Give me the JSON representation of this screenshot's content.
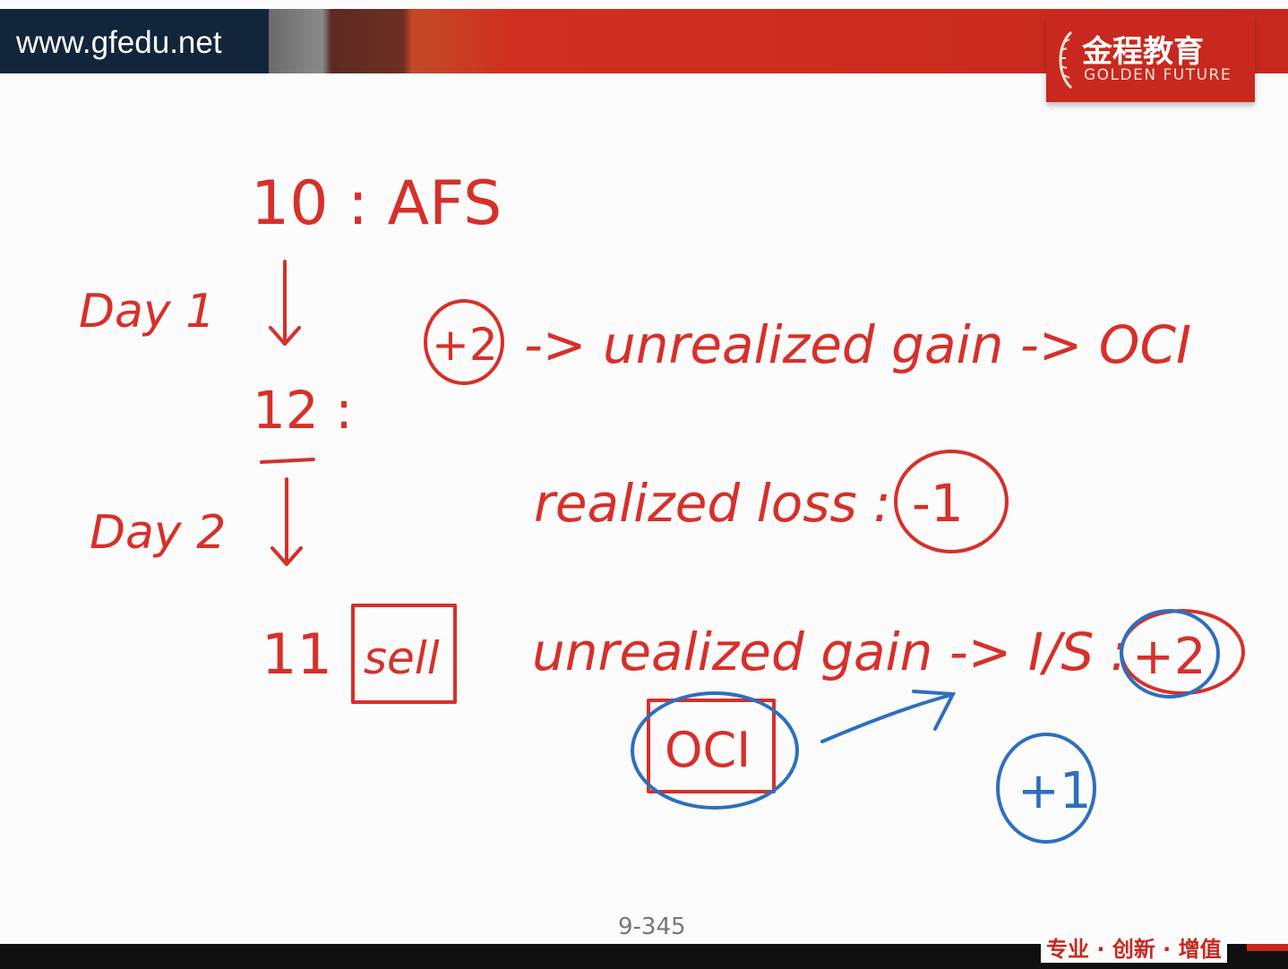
{
  "header": {
    "site_url": "www.gfedu.net",
    "brand_cn": "金程教育",
    "brand_en": "GOLDEN FUTURE"
  },
  "notes": {
    "initial": "10 : AFS",
    "day1_label": "Day 1",
    "day1_circle": "+2",
    "day1_text": "-> unrealized gain -> OCI",
    "day1_price": "12 :",
    "day2_label": "Day 2",
    "realized_loss": "realized loss :",
    "realized_loss_circle": "-1",
    "day2_price": "11",
    "sell_box": "sell",
    "unrealized_text": "unrealized gain -> I/S :",
    "is_circle": "+2",
    "oci_box": "OCI",
    "plus_one_circle": "+1"
  },
  "footer": {
    "page_number": "9-345",
    "slogan": "专业 · 创新 · 增值"
  },
  "colors": {
    "ink_red": "#d6302a",
    "ink_blue": "#2e6fbd",
    "brand_red": "#c8281f"
  }
}
